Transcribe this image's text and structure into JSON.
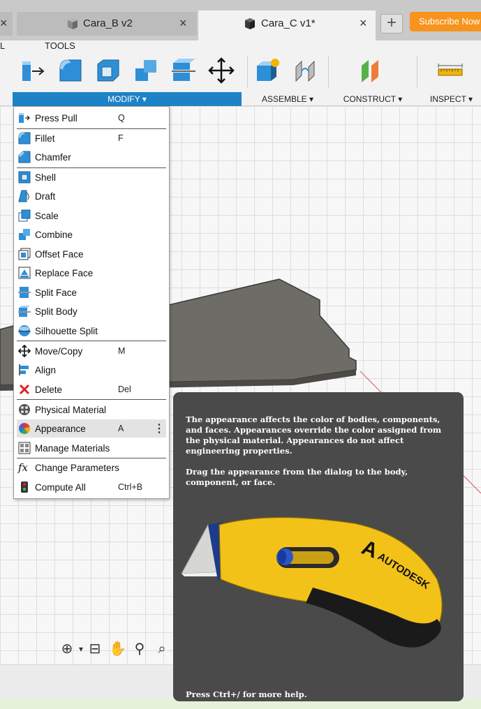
{
  "tabs": {
    "left_close": "×",
    "tab_b": {
      "label": "Cara_B v2",
      "close": "×"
    },
    "tab_c": {
      "label": "Cara_C v1*",
      "close": "×"
    },
    "new_tab": "+",
    "subscribe": "Subscribe Now"
  },
  "ribbon": {
    "tabs": [
      "L",
      "TOOLS"
    ],
    "groups": {
      "modify": "MODIFY ▾",
      "assemble": "ASSEMBLE ▾",
      "construct": "CONSTRUCT ▾",
      "inspect": "INSPECT ▾"
    }
  },
  "menu": {
    "items": [
      {
        "label": "Press Pull",
        "shortcut": "Q",
        "icon": "press-pull-icon"
      },
      {
        "label": "Fillet",
        "shortcut": "F",
        "icon": "fillet-icon"
      },
      {
        "label": "Chamfer",
        "shortcut": "",
        "icon": "chamfer-icon"
      },
      {
        "label": "Shell",
        "shortcut": "",
        "icon": "shell-icon"
      },
      {
        "label": "Draft",
        "shortcut": "",
        "icon": "draft-icon"
      },
      {
        "label": "Scale",
        "shortcut": "",
        "icon": "scale-icon"
      },
      {
        "label": "Combine",
        "shortcut": "",
        "icon": "combine-icon"
      },
      {
        "label": "Offset Face",
        "shortcut": "",
        "icon": "offset-face-icon"
      },
      {
        "label": "Replace Face",
        "shortcut": "",
        "icon": "replace-face-icon"
      },
      {
        "label": "Split Face",
        "shortcut": "",
        "icon": "split-face-icon"
      },
      {
        "label": "Split Body",
        "shortcut": "",
        "icon": "split-body-icon"
      },
      {
        "label": "Silhouette Split",
        "shortcut": "",
        "icon": "silhouette-split-icon"
      },
      {
        "label": "Move/Copy",
        "shortcut": "M",
        "icon": "move-icon"
      },
      {
        "label": "Align",
        "shortcut": "",
        "icon": "align-icon"
      },
      {
        "label": "Delete",
        "shortcut": "Del",
        "icon": "delete-icon"
      },
      {
        "label": "Physical Material",
        "shortcut": "",
        "icon": "physical-material-icon"
      },
      {
        "label": "Appearance",
        "shortcut": "A",
        "icon": "appearance-icon",
        "more": "⋮"
      },
      {
        "label": "Manage Materials",
        "shortcut": "",
        "icon": "manage-materials-icon"
      },
      {
        "label": "Change Parameters",
        "shortcut": "",
        "icon": "fx-icon"
      },
      {
        "label": "Compute All",
        "shortcut": "Ctrl+B",
        "icon": "compute-all-icon"
      }
    ]
  },
  "tooltip": {
    "p1": "The appearance affects the color of bodies, components, and faces. Appearances override the color assigned from the physical material. Appearances do not affect engineering properties.",
    "p2": "Drag the appearance from the dialog to the body, component, or face.",
    "logo_text": "AUTODESK",
    "help": "Press Ctrl+/ for more help."
  },
  "colors": {
    "accent": "#1e82c7",
    "subscribe": "#f7941d",
    "tooltip_bg": "#4a4a4a",
    "knife_yellow": "#f2c218"
  }
}
